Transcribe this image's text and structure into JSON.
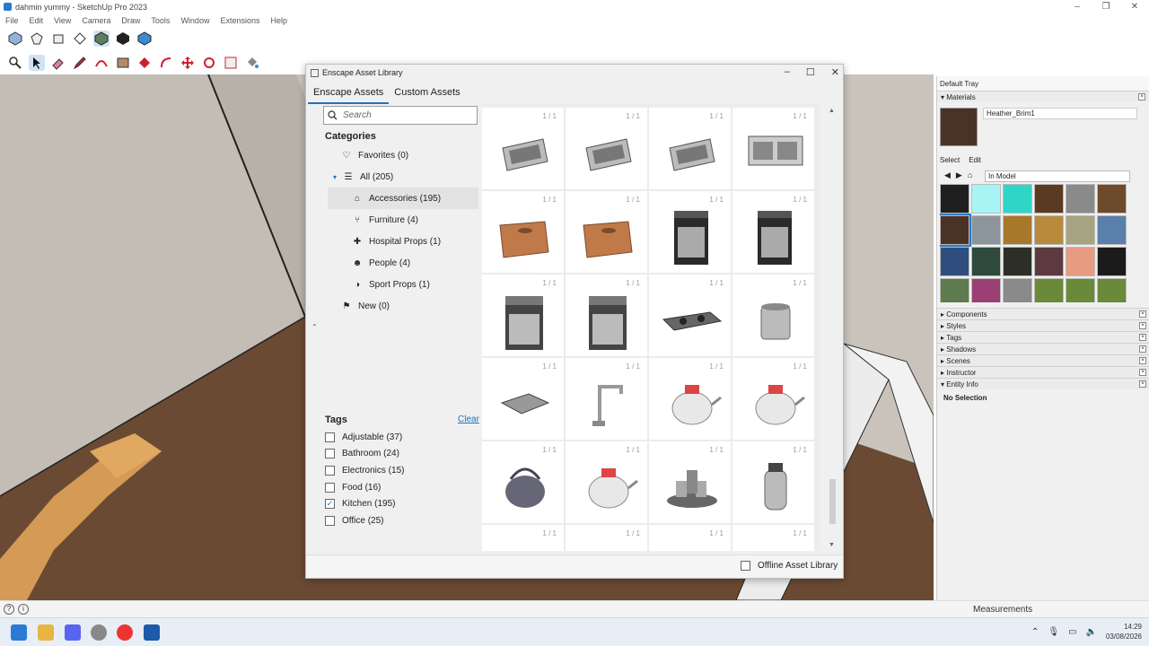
{
  "window": {
    "title": "dahmin yummy - SketchUp Pro 2023"
  },
  "menu": [
    "File",
    "Edit",
    "View",
    "Camera",
    "Draw",
    "Tools",
    "Window",
    "Extensions",
    "Help"
  ],
  "dialog": {
    "title": "Enscape Asset Library",
    "tabs": [
      {
        "label": "Enscape Assets",
        "active": true
      },
      {
        "label": "Custom Assets",
        "active": false
      }
    ],
    "search_placeholder": "Search",
    "categories_title": "Categories",
    "categories": [
      {
        "label": "Favorites (0)",
        "icon": "heart-icon"
      },
      {
        "label": "All (205)",
        "icon": "list-icon"
      },
      {
        "label": "Accessories (195)",
        "icon": "lamp-icon",
        "selected": true
      },
      {
        "label": "Furniture (4)",
        "icon": "chair-icon"
      },
      {
        "label": "Hospital Props (1)",
        "icon": "medkit-icon"
      },
      {
        "label": "People (4)",
        "icon": "people-icon"
      },
      {
        "label": "Sport Props (1)",
        "icon": "whistle-icon"
      },
      {
        "label": "New (0)",
        "icon": "flag-icon"
      }
    ],
    "tags_title": "Tags",
    "clear_label": "Clear",
    "tags": [
      {
        "label": "Adjustable (37)",
        "checked": false
      },
      {
        "label": "Bathroom (24)",
        "checked": false
      },
      {
        "label": "Electronics (15)",
        "checked": false
      },
      {
        "label": "Food (16)",
        "checked": false
      },
      {
        "label": "Kitchen (195)",
        "checked": true
      },
      {
        "label": "Office (25)",
        "checked": false
      }
    ],
    "asset_count_label": "1 / 1",
    "assets": [
      "sink-icon",
      "sink-icon",
      "sink-icon",
      "double-sink-icon",
      "crate-icon",
      "crate-icon",
      "oven-icon",
      "oven-icon",
      "stove-icon",
      "stove-icon",
      "cooktop-icon",
      "pot-icon",
      "tray-icon",
      "faucet-icon",
      "teapot-icon",
      "teapot-icon",
      "kettle-icon",
      "teapot-icon",
      "cup-set-icon",
      "thermos-icon",
      "cone-icon",
      "cone-icon",
      "cone-icon",
      "cone-icon"
    ],
    "offline_label": "Offline Asset Library"
  },
  "tray": {
    "title": "Default Tray",
    "materials_label": "Materials",
    "material_name": "Heather_Brim1",
    "select_label": "Select",
    "edit_label": "Edit",
    "in_model_label": "In Model",
    "swatches": [
      "#1f1f1f",
      "#a7f4f4",
      "#2fd6c7",
      "#5b3a22",
      "#8a8a8a",
      "#6e4a2c",
      "#4b3226",
      "#8c959c",
      "#a8782a",
      "#b88a3c",
      "#a6a480",
      "#5a7faa",
      "#2e4f7e",
      "#2d4a3c",
      "#2d2f26",
      "#5d3a3f",
      "#e89b80",
      "#1b1b1b",
      "#5e7b4e",
      "#9b3f74",
      "#8a8a8a",
      "#6a8a3a",
      "#6a8a3a",
      "#6a8a3a"
    ],
    "sections": [
      "Components",
      "Styles",
      "Tags",
      "Shadows",
      "Scenes",
      "Instructor",
      "Entity Info"
    ],
    "entity_info": "No Selection"
  },
  "status": {
    "measurements": "Measurements"
  },
  "taskbar": {
    "time": "14:29",
    "date": "03/08/2026"
  }
}
